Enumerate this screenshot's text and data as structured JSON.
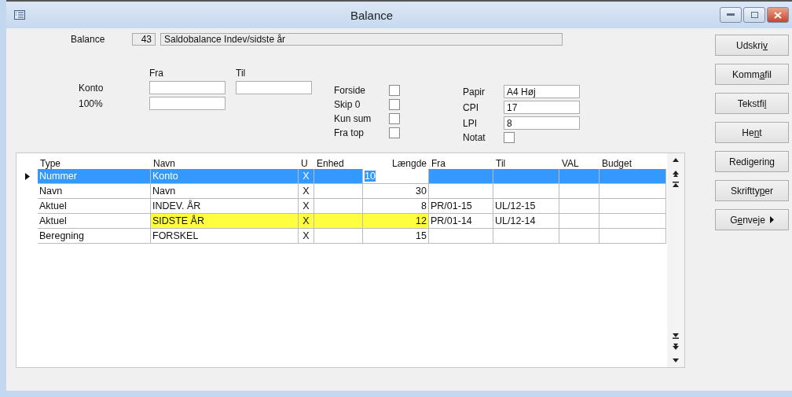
{
  "window": {
    "title": "Balance"
  },
  "header": {
    "label": "Balance",
    "number": "43",
    "description": "Saldobalance Indev/sidste år"
  },
  "range": {
    "from_label": "Fra",
    "to_label": "Til",
    "rows": [
      {
        "label": "Konto",
        "kind": "pair"
      },
      {
        "label": "100%",
        "kind": "single"
      }
    ]
  },
  "options": [
    {
      "label": "Forside",
      "checked": false
    },
    {
      "label": "Skip 0",
      "checked": false
    },
    {
      "label": "Kun sum",
      "checked": false
    },
    {
      "label": "Fra top",
      "checked": false
    }
  ],
  "print": [
    {
      "label": "Papir",
      "kind": "field",
      "value": "A4 Høj"
    },
    {
      "label": "CPI",
      "kind": "field",
      "value": "17"
    },
    {
      "label": "LPI",
      "kind": "field",
      "value": "8"
    },
    {
      "label": "Notat",
      "kind": "checkbox",
      "checked": false
    }
  ],
  "buttons": [
    {
      "label_parts": [
        "Udskri",
        "v"
      ],
      "menu": false
    },
    {
      "label_parts": [
        "Komm",
        "a",
        "fil"
      ],
      "menu": false
    },
    {
      "label_parts": [
        "Tekstfi",
        "l"
      ],
      "menu": false
    },
    {
      "label_parts": [
        "He",
        "n",
        "t"
      ],
      "menu": false
    },
    {
      "label_parts": [
        "Redi",
        "g",
        "ering"
      ],
      "menu": false
    },
    {
      "label_parts": [
        "Skriftty",
        "p",
        "er"
      ],
      "menu": false
    },
    {
      "label_parts": [
        "G",
        "e",
        "nveje"
      ],
      "menu": true
    }
  ],
  "table": {
    "columns": [
      "Type",
      "Navn",
      "U",
      "Enhed",
      "Længde",
      "Fra",
      "Til",
      "VAL",
      "Budget"
    ],
    "rows": [
      {
        "selected": true,
        "highlighted": false,
        "cells": [
          "Nummer",
          "Konto",
          "X",
          null,
          "10",
          null,
          null,
          null,
          null
        ]
      },
      {
        "selected": false,
        "highlighted": false,
        "cells": [
          "Navn",
          "Navn",
          "X",
          null,
          "30",
          null,
          null,
          null,
          null
        ]
      },
      {
        "selected": false,
        "highlighted": false,
        "cells": [
          "Aktuel",
          "INDEV. ÅR",
          "X",
          null,
          "8",
          "PR/01-15",
          "UL/12-15",
          null,
          null
        ]
      },
      {
        "selected": false,
        "highlighted": true,
        "cells": [
          "Aktuel",
          "SIDSTE ÅR",
          "X",
          null,
          "12",
          "PR/01-14",
          "UL/12-14",
          null,
          null
        ]
      },
      {
        "selected": false,
        "highlighted": false,
        "cells": [
          "Beregning",
          "FORSKEL",
          "X",
          null,
          "15",
          null,
          null,
          null,
          null
        ]
      }
    ]
  }
}
